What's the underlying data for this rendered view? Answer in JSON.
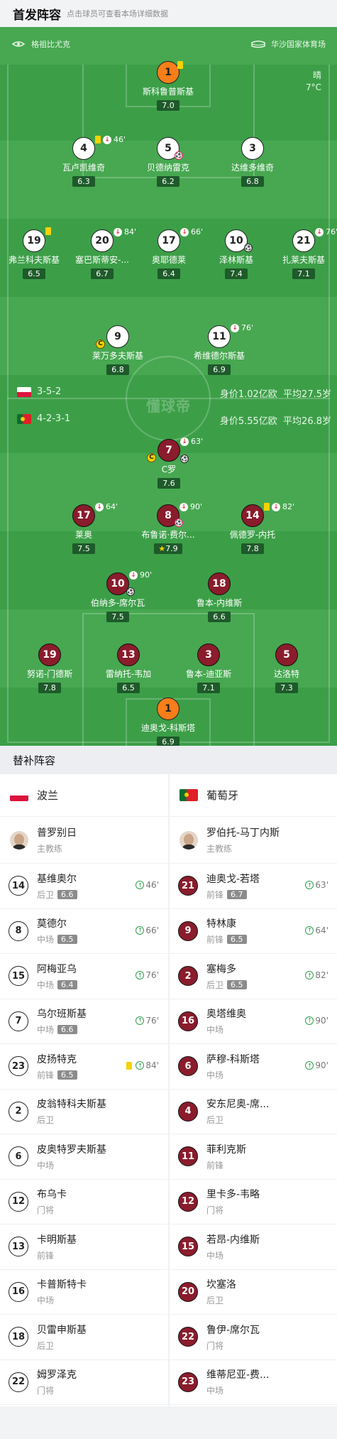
{
  "header": {
    "title": "首发阵容",
    "hint": "点击球员可查看本场详细数据"
  },
  "pitch": {
    "home_team_label": "格祖比尤克",
    "venue_label": "华沙国家体育场",
    "weather": "晴",
    "temperature": "7°C",
    "watermark": "懂球帝",
    "poland_formation": "3-5-2",
    "poland_value": "身价1.02亿欧",
    "poland_age": "平均27.5岁",
    "portugal_formation": "4-2-3-1",
    "portugal_value": "身价5.55亿欧",
    "portugal_age": "平均26.8岁"
  },
  "poland_players": [
    {
      "num": "1",
      "name": "斯科鲁普斯基",
      "rating": "7.0",
      "event": ""
    },
    {
      "num": "4",
      "name": "瓦卢凯维奇",
      "rating": "6.3",
      "event": "46'"
    },
    {
      "num": "5",
      "name": "贝德纳雷克",
      "rating": "6.2",
      "event": ""
    },
    {
      "num": "3",
      "name": "达维多维奇",
      "rating": "6.8",
      "event": ""
    },
    {
      "num": "19",
      "name": "弗兰科夫斯基",
      "rating": "6.5",
      "event": ""
    },
    {
      "num": "20",
      "name": "塞巴斯蒂安-...",
      "rating": "6.7",
      "event": "84'"
    },
    {
      "num": "17",
      "name": "奥耶德莱",
      "rating": "6.4",
      "event": "66'"
    },
    {
      "num": "10",
      "name": "泽林斯基",
      "rating": "7.4",
      "event": ""
    },
    {
      "num": "21",
      "name": "扎莱夫斯基",
      "rating": "7.1",
      "event": "76'"
    },
    {
      "num": "9",
      "name": "莱万多夫斯基",
      "rating": "6.8",
      "event": ""
    },
    {
      "num": "11",
      "name": "希维德尔斯基",
      "rating": "6.9",
      "event": "76'"
    }
  ],
  "portugal_players": [
    {
      "num": "7",
      "name": "C罗",
      "rating": "7.6",
      "event": "63'"
    },
    {
      "num": "17",
      "name": "莱奥",
      "rating": "7.5",
      "event": "64'"
    },
    {
      "num": "8",
      "name": "布鲁诺·费尔...",
      "rating": "7.9",
      "event": "90'"
    },
    {
      "num": "14",
      "name": "佩德罗-内托",
      "rating": "7.8",
      "event": "82'"
    },
    {
      "num": "10",
      "name": "伯纳多-席尔瓦",
      "rating": "7.5",
      "event": "90'"
    },
    {
      "num": "18",
      "name": "鲁本-内维斯",
      "rating": "6.6",
      "event": ""
    },
    {
      "num": "19",
      "name": "努诺-门德斯",
      "rating": "7.8",
      "event": ""
    },
    {
      "num": "13",
      "name": "雷纳托-韦加",
      "rating": "6.5",
      "event": ""
    },
    {
      "num": "3",
      "name": "鲁本-迪亚斯",
      "rating": "7.1",
      "event": ""
    },
    {
      "num": "5",
      "name": "达洛特",
      "rating": "7.3",
      "event": ""
    },
    {
      "num": "1",
      "name": "迪奥戈-科斯塔",
      "rating": "6.9",
      "event": ""
    }
  ],
  "subs": {
    "title": "替补阵容",
    "poland": {
      "team": "波兰",
      "coach": "普罗别日",
      "coach_role": "主教练",
      "players": [
        {
          "num": "14",
          "name": "基维奥尔",
          "pos": "后卫",
          "rating": "6.6",
          "in": "46'"
        },
        {
          "num": "8",
          "name": "莫德尔",
          "pos": "中场",
          "rating": "6.5",
          "in": "66'"
        },
        {
          "num": "15",
          "name": "阿梅亚乌",
          "pos": "中场",
          "rating": "6.4",
          "in": "76'"
        },
        {
          "num": "7",
          "name": "乌尔班斯基",
          "pos": "中场",
          "rating": "6.6",
          "in": "76'"
        },
        {
          "num": "23",
          "name": "皮扬特克",
          "pos": "前锋",
          "rating": "6.5",
          "in": "84'"
        },
        {
          "num": "2",
          "name": "皮翁特科夫斯基",
          "pos": "后卫",
          "rating": "",
          "in": ""
        },
        {
          "num": "6",
          "name": "皮奥特罗夫斯基",
          "pos": "中场",
          "rating": "",
          "in": ""
        },
        {
          "num": "12",
          "name": "布乌卡",
          "pos": "门将",
          "rating": "",
          "in": ""
        },
        {
          "num": "13",
          "name": "卡明斯基",
          "pos": "前锋",
          "rating": "",
          "in": ""
        },
        {
          "num": "16",
          "name": "卡普斯特卡",
          "pos": "中场",
          "rating": "",
          "in": ""
        },
        {
          "num": "18",
          "name": "贝雷申斯基",
          "pos": "后卫",
          "rating": "",
          "in": ""
        },
        {
          "num": "22",
          "name": "姆罗泽克",
          "pos": "门将",
          "rating": "",
          "in": ""
        }
      ]
    },
    "portugal": {
      "team": "葡萄牙",
      "coach": "罗伯托-马丁内斯",
      "coach_role": "主教练",
      "players": [
        {
          "num": "21",
          "name": "迪奥戈-若塔",
          "pos": "前锋",
          "rating": "6.7",
          "in": "63'"
        },
        {
          "num": "9",
          "name": "特林康",
          "pos": "前锋",
          "rating": "6.5",
          "in": "64'"
        },
        {
          "num": "2",
          "name": "塞梅多",
          "pos": "后卫",
          "rating": "6.5",
          "in": "82'"
        },
        {
          "num": "16",
          "name": "奥塔维奥",
          "pos": "中场",
          "rating": "",
          "in": "90'"
        },
        {
          "num": "6",
          "name": "萨穆-科斯塔",
          "pos": "中场",
          "rating": "",
          "in": "90'"
        },
        {
          "num": "4",
          "name": "安东尼奥-席...",
          "pos": "后卫",
          "rating": "",
          "in": ""
        },
        {
          "num": "11",
          "name": "菲利克斯",
          "pos": "前锋",
          "rating": "",
          "in": ""
        },
        {
          "num": "12",
          "name": "里卡多-韦略",
          "pos": "门将",
          "rating": "",
          "in": ""
        },
        {
          "num": "15",
          "name": "若昂-内维斯",
          "pos": "中场",
          "rating": "",
          "in": ""
        },
        {
          "num": "20",
          "name": "坎塞洛",
          "pos": "后卫",
          "rating": "",
          "in": ""
        },
        {
          "num": "22",
          "name": "鲁伊-席尔瓦",
          "pos": "门将",
          "rating": "",
          "in": ""
        },
        {
          "num": "23",
          "name": "维蒂尼亚-费...",
          "pos": "中场",
          "rating": "",
          "in": ""
        }
      ]
    }
  }
}
